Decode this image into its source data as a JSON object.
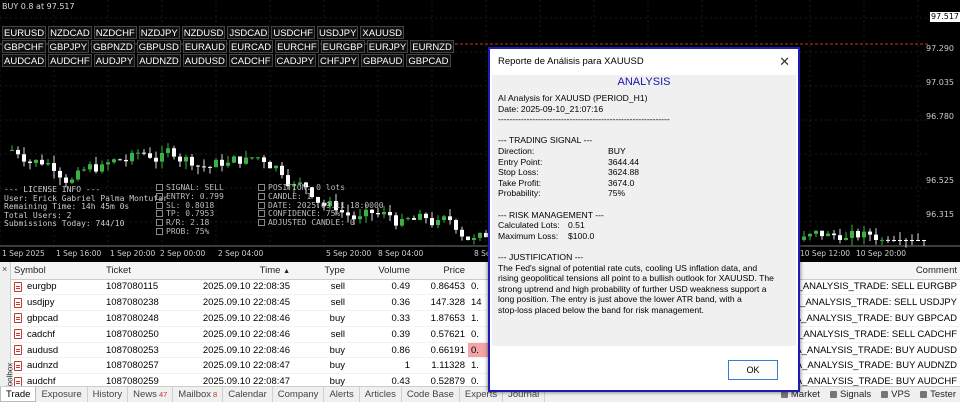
{
  "chart": {
    "header": "BUY 0.8 at 97.517",
    "symbol_rows": [
      [
        "EURUSD",
        "NZDCAD",
        "NZDCHF",
        "NZDJPY",
        "NZDUSD",
        "JSDCAD",
        "USDCHF",
        "USDJPY",
        "XAUUSD"
      ],
      [
        "GBPCHF",
        "GBPJPY",
        "GBPNZD",
        "GBPUSD",
        "EURAUD",
        "EURCAD",
        "EURCHF",
        "EURGBP",
        "EURJPY",
        "EURNZD"
      ],
      [
        "AUDCAD",
        "AUDCHF",
        "AUDJPY",
        "AUDNZD",
        "AUDUSD",
        "CADCHF",
        "CADJPY",
        "CHFJPY",
        "GBPAUD",
        "GBPCAD"
      ]
    ],
    "price_levels": [
      "97.290",
      "97.035",
      "96.780",
      "96.525",
      "96.315"
    ],
    "current_price": "97.517",
    "time_labels": [
      "1 Sep 2025",
      "1 Sep 16:00",
      "1 Sep 20:00",
      "2 Sep 00:00",
      "2 Sep 04:00",
      "5 Sep 20:00",
      "8 Sep 04:00",
      "8 Sep 12:00",
      "10 Sep 04:00",
      "10 Sep 12:00",
      "10 Sep 20:00"
    ],
    "info_left": [
      "--- LICENSE INFO ---",
      "User: Erick Gabriel Palma Montufar",
      "Remaining Time: 14h 45m 0s",
      "Total Users: 2",
      "Submissions Today: 744/10"
    ],
    "info_mid": [
      "SIGNAL: SELL",
      "ENTRY: 0.799",
      "SL: 0.8018",
      "TP: 0.7953",
      "R/R: 2.18",
      "PROB: 75%"
    ],
    "info_right": [
      "POSITION: 0 lots",
      "CANDLE: 1",
      "DATE: 2025.09.11 18:0000",
      "CONFIDENCE: 75%",
      "ADJUSTED CANDLE: 0"
    ]
  },
  "dialog": {
    "title": "Reporte de Análisis para XAUUSD",
    "close": "✕",
    "heading": "ANALYSIS",
    "intro": [
      "AI Analysis for XAUUSD (PERIOD_H1)",
      "Date: 2025-09-10_21:07:16",
      "------------------------------------------------------------"
    ],
    "signal_header": "--- TRADING SIGNAL ---",
    "signal": [
      {
        "k": "Direction:",
        "v": "BUY"
      },
      {
        "k": "Entry Point:",
        "v": "3644.44"
      },
      {
        "k": "Stop Loss:",
        "v": "3624.88"
      },
      {
        "k": "Take Profit:",
        "v": "3674.0"
      },
      {
        "k": "Probability:",
        "v": "75%"
      }
    ],
    "risk_header": "--- RISK MANAGEMENT ---",
    "risk": [
      {
        "k": "Calculated Lots:",
        "v": "0.51"
      },
      {
        "k": "Maximum Loss:",
        "v": "$100.0"
      }
    ],
    "just_header": "--- JUSTIFICATION ---",
    "justification": [
      "The Fed's signal of potential rate cuts, cooling US inflation data, and",
      "rising geopolitical tensions all point to a bullish outlook for XAUUSD. The",
      "strong uptrend and high probability of further USD weakness support a",
      "long position. The entry is just above the lower ATR band, with a",
      "stop-loss placed below the band for risk management."
    ],
    "ok": "OK"
  },
  "table": {
    "headers": {
      "symbol": "Symbol",
      "ticket": "Ticket",
      "time": "Time",
      "sort": "▲",
      "type": "Type",
      "volume": "Volume",
      "price": "Price",
      "comment": "Comment"
    },
    "rows": [
      {
        "symbol": "eurgbp",
        "ticket": "1087080115",
        "time": "2025.09.10 22:08:35",
        "type": "sell",
        "volume": "0.49",
        "price": "0.86453",
        "rest": "0.",
        "comment": "IA_ANALYSIS_TRADE: SELL EURGBP",
        "hl": false
      },
      {
        "symbol": "usdjpy",
        "ticket": "1087080238",
        "time": "2025.09.10 22:08:45",
        "type": "sell",
        "volume": "0.36",
        "price": "147.328",
        "rest": "14",
        "comment": "IA_ANALYSIS_TRADE: SELL USDJPY",
        "hl": false
      },
      {
        "symbol": "gbpcad",
        "ticket": "1087080248",
        "time": "2025.09.10 22:08:46",
        "type": "buy",
        "volume": "0.33",
        "price": "1.87653",
        "rest": "1.",
        "comment": "IA_ANALYSIS_TRADE: BUY GBPCAD",
        "hl": false
      },
      {
        "symbol": "cadchf",
        "ticket": "1087080250",
        "time": "2025.09.10 22:08:46",
        "type": "sell",
        "volume": "0.39",
        "price": "0.57621",
        "rest": "0.",
        "comment": "IA_ANALYSIS_TRADE: SELL CADCHF",
        "hl": false
      },
      {
        "symbol": "audusd",
        "ticket": "1087080253",
        "time": "2025.09.10 22:08:46",
        "type": "buy",
        "volume": "0.86",
        "price": "0.66191",
        "rest": "0.",
        "comment": "IA_ANALYSIS_TRADE: BUY AUDUSD",
        "hl": true
      },
      {
        "symbol": "audnzd",
        "ticket": "1087080257",
        "time": "2025.09.10 22:08:47",
        "type": "buy",
        "volume": "1",
        "price": "1.11328",
        "rest": "1.",
        "comment": "IA_ANALYSIS_TRADE: BUY AUDNZD",
        "hl": false
      },
      {
        "symbol": "audchf",
        "ticket": "1087080259",
        "time": "2025.09.10 22:08:47",
        "type": "buy",
        "volume": "0.43",
        "price": "0.52879",
        "rest": "0.",
        "comment": "IA_ANALYSIS_TRADE: BUY AUDCHF",
        "hl": false
      }
    ]
  },
  "toolbox": {
    "label": "Toolbox",
    "close": "×"
  },
  "tabs": [
    {
      "label": "Trade",
      "count": "",
      "active": true
    },
    {
      "label": "Exposure",
      "count": ""
    },
    {
      "label": "History",
      "count": ""
    },
    {
      "label": "News",
      "count": "47"
    },
    {
      "label": "Mailbox",
      "count": "8"
    },
    {
      "label": "Calendar",
      "count": ""
    },
    {
      "label": "Company",
      "count": ""
    },
    {
      "label": "Alerts",
      "count": ""
    },
    {
      "label": "Articles",
      "count": ""
    },
    {
      "label": "Code Base",
      "count": ""
    },
    {
      "label": "Experts",
      "count": ""
    },
    {
      "label": "Journal",
      "count": ""
    }
  ],
  "tabs_right": [
    "Market",
    "Signals",
    "VPS",
    "Tester"
  ]
}
